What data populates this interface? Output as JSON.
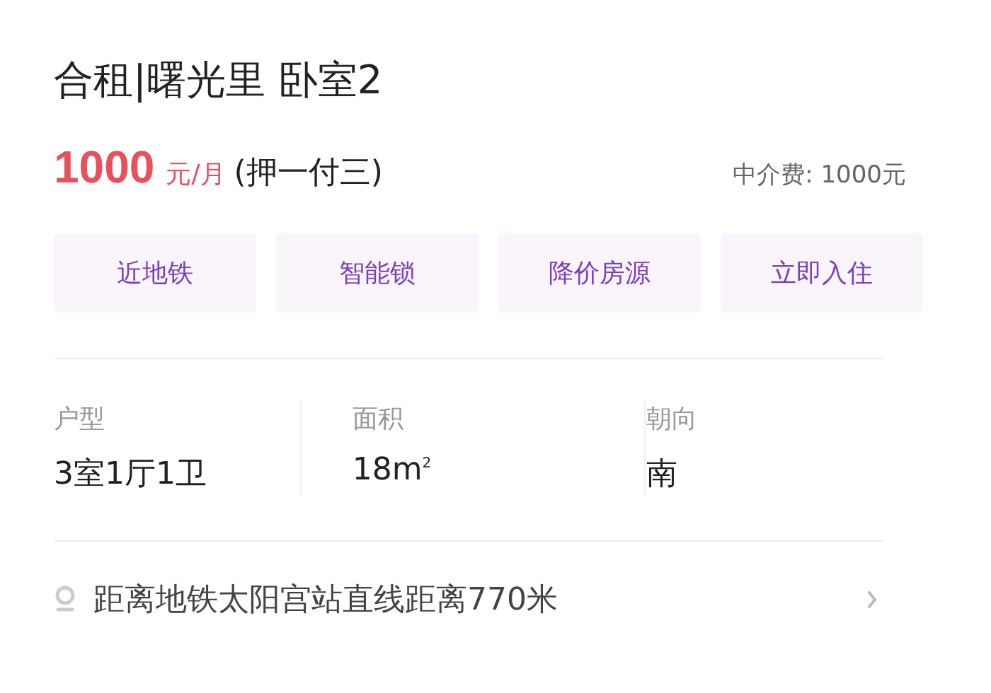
{
  "title": "合租|曙光里 卧室2",
  "price": {
    "amount": "1000",
    "unit": "元/月",
    "payment": "(押一付三)",
    "agency_fee": "中介费: 1000元"
  },
  "tags": [
    "近地铁",
    "智能锁",
    "降价房源",
    "立即入住"
  ],
  "specs": [
    {
      "label": "户型",
      "value": "3室1厅1卫"
    },
    {
      "label": "面积",
      "value": "18m$^{2}$"
    },
    {
      "label": "朝向",
      "value": "南"
    }
  ],
  "location": {
    "text": "距离地铁太阳宫站直线距离770米"
  }
}
